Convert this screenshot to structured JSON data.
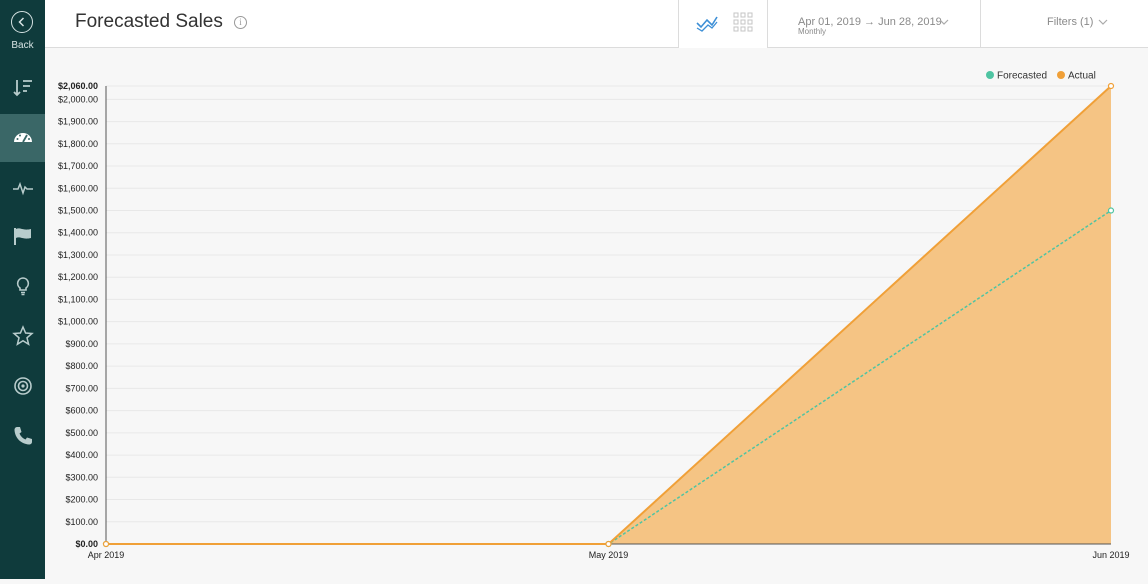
{
  "sidebar": {
    "back_label": "Back",
    "items": [
      {
        "icon": "sort-list-icon"
      },
      {
        "icon": "dashboard-icon",
        "active": true
      },
      {
        "icon": "activity-icon"
      },
      {
        "icon": "flag-icon"
      },
      {
        "icon": "lightbulb-icon"
      },
      {
        "icon": "star-icon"
      },
      {
        "icon": "target-icon"
      },
      {
        "icon": "phone-icon"
      }
    ]
  },
  "header": {
    "title": "Forecasted Sales",
    "info_glyph": "i",
    "date_range": "Apr 01, 2019 → Jun 28, 2019",
    "granularity": "Monthly",
    "filters_label": "Filters (1)"
  },
  "colors": {
    "sidebar_bg": "#0f3b3c",
    "sidebar_active": "#3a6767",
    "forecasted": "#4fc4a2",
    "actual": "#f0a038",
    "actual_fill": "#f5c484",
    "accent_blue": "#3d8fd6"
  },
  "chart_data": {
    "type": "area",
    "categories": [
      "Apr 2019",
      "May 2019",
      "Jun 2019"
    ],
    "series": [
      {
        "name": "Forecasted",
        "values": [
          0,
          0,
          1500
        ]
      },
      {
        "name": "Actual",
        "values": [
          0,
          0,
          2060
        ]
      }
    ],
    "y_ticks": [
      "$0.00",
      "$100.00",
      "$200.00",
      "$300.00",
      "$400.00",
      "$500.00",
      "$600.00",
      "$700.00",
      "$800.00",
      "$900.00",
      "$1,000.00",
      "$1,100.00",
      "$1,200.00",
      "$1,300.00",
      "$1,400.00",
      "$1,500.00",
      "$1,600.00",
      "$1,700.00",
      "$1,800.00",
      "$1,900.00",
      "$2,000.00",
      "$2,060.00"
    ],
    "ylim": [
      0,
      2060
    ],
    "legend_position": "top-right",
    "grid": true
  }
}
